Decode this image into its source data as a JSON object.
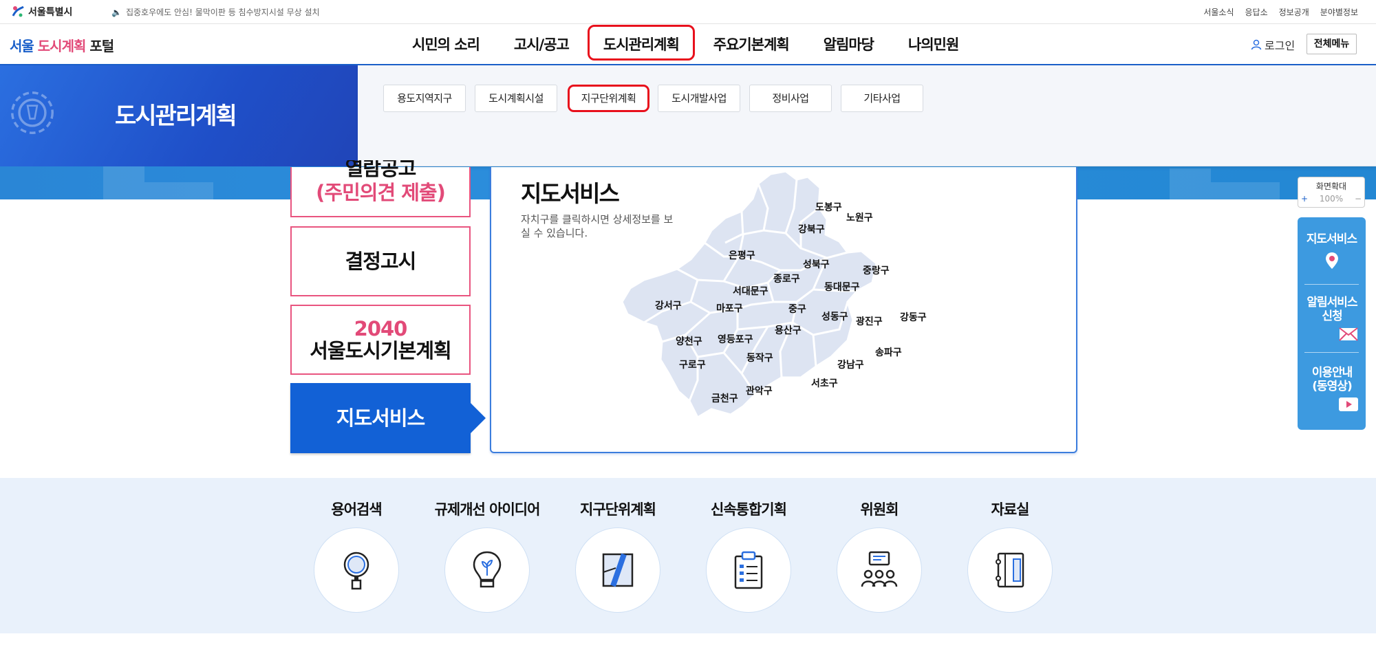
{
  "util": {
    "seoul_label": "서울특별시",
    "notice": "집중호우에도 안심! 물막이판 등 침수방지시설 무상 설치",
    "links": [
      "서울소식",
      "응답소",
      "정보공개",
      "분야별정보"
    ]
  },
  "header": {
    "logo_part1": "서울",
    "logo_part2": "도시계획",
    "logo_part3": "포털",
    "gnb": [
      "시민의 소리",
      "고시/공고",
      "도시관리계획",
      "주요기본계획",
      "알림마당",
      "나의민원"
    ],
    "login": "로그인",
    "all_menu": "전체메뉴"
  },
  "mega": {
    "title": "도시관리계획",
    "subs": [
      "용도지역지구",
      "도시계획시설",
      "지구단위계획",
      "도시개발사업",
      "정비사업",
      "기타사업"
    ]
  },
  "left_menu": {
    "box1_line1": "열람공고",
    "box1_line2": "(주민의견 제출)",
    "box2": "결정고시",
    "box3_line1": "2040",
    "box3_line2": "서울도시기본계획",
    "box4": "지도서비스"
  },
  "map": {
    "title": "지도서비스",
    "desc": "자치구를 클릭하시면 상세정보를 보실 수 있습니다.",
    "districts": [
      "도봉구",
      "노원구",
      "강북구",
      "은평구",
      "성북구",
      "중랑구",
      "종로구",
      "서대문구",
      "동대문구",
      "강서구",
      "마포구",
      "중구",
      "성동구",
      "광진구",
      "강동구",
      "용산구",
      "양천구",
      "영등포구",
      "동작구",
      "송파구",
      "구로구",
      "강남구",
      "서초구",
      "관악구",
      "금천구"
    ]
  },
  "quick": {
    "zoom_label": "화면확대",
    "zoom_plus": "+",
    "zoom_value": "100%",
    "zoom_minus": "−",
    "items": [
      "지도서비스",
      "알림서비스 신청",
      "이용안내 (동영상)"
    ]
  },
  "bottom_links": [
    "용어검색",
    "규제개선 아이디어",
    "지구단위계획",
    "신속통합기획",
    "위원회",
    "자료실"
  ],
  "colors": {
    "primary": "#1a5fc9",
    "accent_pink": "#e24a78",
    "highlight_red": "#e8101c",
    "quick_blue": "#3d9ae0"
  }
}
